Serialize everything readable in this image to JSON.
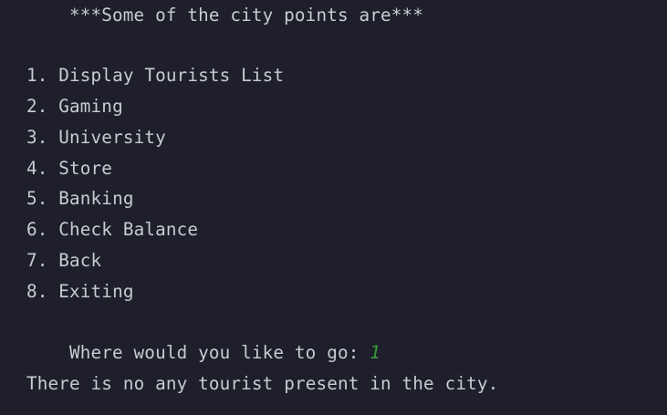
{
  "console": {
    "header": "***Some of the city points are***",
    "menu": [
      "1. Display Tourists List",
      "2. Gaming",
      "3. University",
      "4. Store",
      "5. Banking",
      "6. Check Balance",
      "7. Back",
      "8. Exiting"
    ],
    "prompt": "Where would you like to go: ",
    "user_input": "1",
    "response": "There is no any tourist present in the city."
  },
  "colors": {
    "background": "#1e1f2b",
    "text": "#c8cbd0",
    "user_input": "#3c9b3c"
  }
}
